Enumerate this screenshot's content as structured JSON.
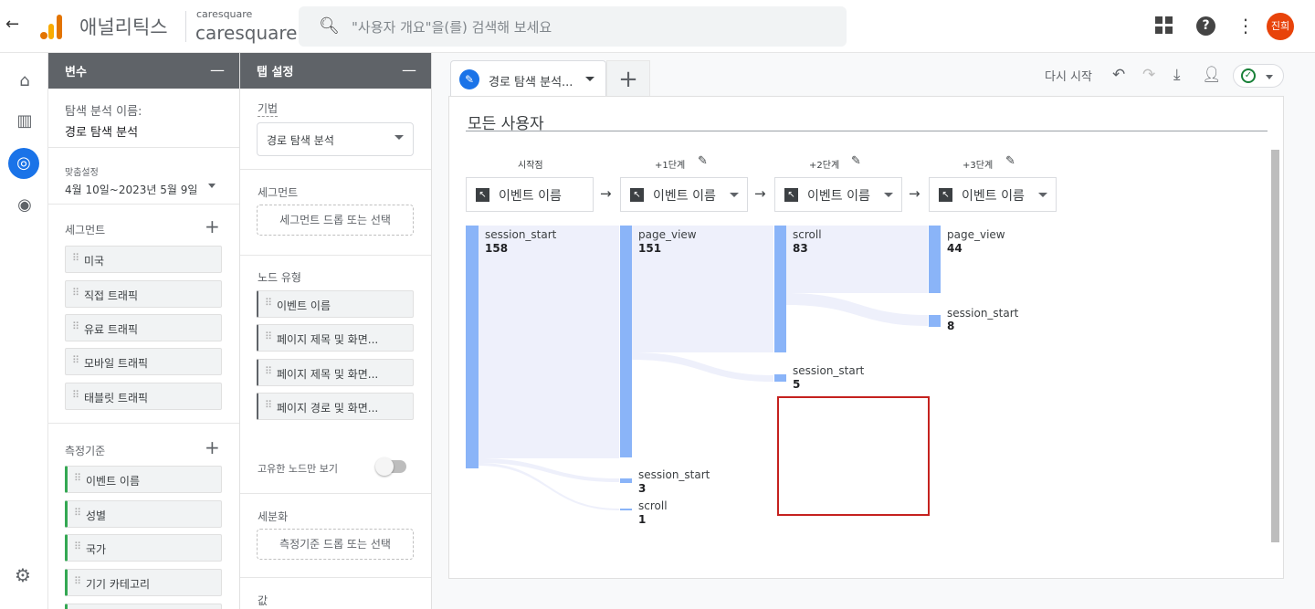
{
  "header": {
    "app_title": "애널리틱스",
    "property_small": "caresquare",
    "property_name": "caresquare",
    "search_placeholder": "\"사용자 개요\"을(를) 검색해 보세요",
    "avatar_text": "진희"
  },
  "variables_panel": {
    "title": "변수",
    "exploration_name_label": "탐색 분석 이름:",
    "exploration_name": "경로 탐색 분석",
    "custom_label": "맞춤설정",
    "date_range": "4월 10일~2023년 5월 9일",
    "segments_label": "세그먼트",
    "segments": [
      "미국",
      "직접 트래픽",
      "유료 트래픽",
      "모바일 트래픽",
      "태블릿 트래픽"
    ],
    "dimensions_label": "측정기준",
    "dimensions": [
      "이벤트 이름",
      "성별",
      "국가",
      "기기 카테고리"
    ]
  },
  "tab_settings_panel": {
    "title": "탭 설정",
    "technique_label": "기법",
    "technique_value": "경로 탐색 분석",
    "segments_label": "세그먼트",
    "segments_drop": "세그먼트 드롭 또는 선택",
    "node_type_label": "노드 유형",
    "node_types": [
      "이벤트 이름",
      "페이지 제목 및 화면...",
      "페이지 제목 및 화면...",
      "페이지 경로 및 화면..."
    ],
    "unique_nodes_label": "고유한 노드만 보기",
    "breakdown_label": "세분화",
    "breakdown_drop": "측정기준 드롭 또는 선택",
    "values_label": "값"
  },
  "canvas": {
    "tab_label": "경로 탐색 분석...",
    "restart_label": "다시 시작",
    "segment_title": "모든 사용자",
    "steps": [
      {
        "label": "시작점",
        "select": "이벤트 이름"
      },
      {
        "label": "+1단계",
        "select": "이벤트 이름"
      },
      {
        "label": "+2단계",
        "select": "이벤트 이름"
      },
      {
        "label": "+3단계",
        "select": "이벤트 이름"
      }
    ],
    "nodes": {
      "start": [
        {
          "name": "session_start",
          "value": "158"
        }
      ],
      "step1": [
        {
          "name": "page_view",
          "value": "151"
        },
        {
          "name": "session_start",
          "value": "3"
        },
        {
          "name": "scroll",
          "value": "1"
        }
      ],
      "step2": [
        {
          "name": "scroll",
          "value": "83"
        },
        {
          "name": "session_start",
          "value": "5"
        }
      ],
      "step3": [
        {
          "name": "page_view",
          "value": "44"
        },
        {
          "name": "session_start",
          "value": "8"
        }
      ]
    }
  },
  "colors": {
    "accent": "#1a73e8",
    "node_bar": "#8ab4f8",
    "flow": "#e8eaf6",
    "highlight_box": "#c5221f",
    "panel_header": "#5f6368"
  }
}
